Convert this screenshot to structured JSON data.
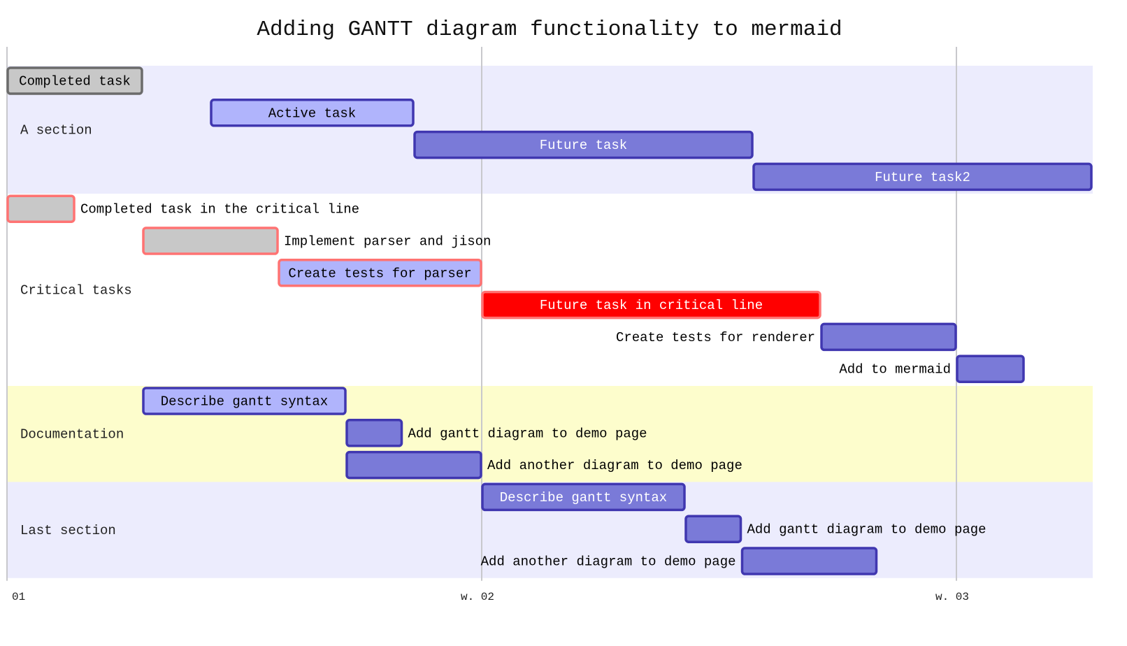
{
  "chart_data": {
    "type": "gantt",
    "title": "Adding GANTT diagram functionality to mermaid",
    "x_unit": "days",
    "x_range": [
      0,
      16
    ],
    "ticks": [
      {
        "day": 0,
        "label": "01"
      },
      {
        "day": 7,
        "label": "w. 02"
      },
      {
        "day": 14,
        "label": "w. 03"
      }
    ],
    "grid": true,
    "sections": [
      {
        "name": "A section",
        "color": "#ececfd",
        "tasks": [
          {
            "label": "Completed task",
            "start": 0,
            "end": 2,
            "status": "done",
            "crit": false
          },
          {
            "label": "Active task",
            "start": 3,
            "end": 6,
            "status": "active",
            "crit": false
          },
          {
            "label": "Future task",
            "start": 6,
            "end": 11,
            "status": "future",
            "crit": false
          },
          {
            "label": "Future task2",
            "start": 11,
            "end": 16,
            "status": "future",
            "crit": false
          }
        ]
      },
      {
        "name": "Critical tasks",
        "color": "#ffffff",
        "tasks": [
          {
            "label": "Completed task in the critical line",
            "start": 0,
            "end": 1,
            "status": "done",
            "crit": true
          },
          {
            "label": "Implement parser and jison",
            "start": 2,
            "end": 4,
            "status": "done",
            "crit": true
          },
          {
            "label": "Create tests for parser",
            "start": 4,
            "end": 7,
            "status": "active",
            "crit": true
          },
          {
            "label": "Future task in critical line",
            "start": 7,
            "end": 12,
            "status": "future",
            "crit": true
          },
          {
            "label": "Create tests for renderer",
            "start": 12,
            "end": 14,
            "status": "future",
            "crit": false
          },
          {
            "label": "Add to mermaid",
            "start": 14,
            "end": 15,
            "status": "future",
            "crit": false
          }
        ]
      },
      {
        "name": "Documentation",
        "color": "#fdfdcc",
        "tasks": [
          {
            "label": "Describe gantt syntax",
            "start": 2,
            "end": 5,
            "status": "active",
            "crit": false
          },
          {
            "label": "Add gantt diagram to demo page",
            "start": 5,
            "end": 5.83,
            "status": "future",
            "crit": false
          },
          {
            "label": "Add another diagram to demo page",
            "start": 5,
            "end": 7,
            "status": "future",
            "crit": false
          }
        ]
      },
      {
        "name": "Last section",
        "color": "#ececfd",
        "tasks": [
          {
            "label": "Describe gantt syntax",
            "start": 7,
            "end": 10,
            "status": "future",
            "crit": false
          },
          {
            "label": "Add gantt diagram to demo page",
            "start": 10,
            "end": 10.83,
            "status": "future",
            "crit": false
          },
          {
            "label": "Add another diagram to demo page",
            "start": 10.83,
            "end": 12.83,
            "status": "future",
            "crit": false
          }
        ]
      }
    ],
    "colors": {
      "done_fill": "#c8c8c8",
      "done_stroke": "#6b6b6b",
      "active_fill": "#b0b4fc",
      "future_fill": "#7a7ad8",
      "task_stroke": "#4037b0",
      "crit_stroke": "#ff7373",
      "crit_future_fill": "#ff0000",
      "grid": "#c8c8cc"
    }
  }
}
